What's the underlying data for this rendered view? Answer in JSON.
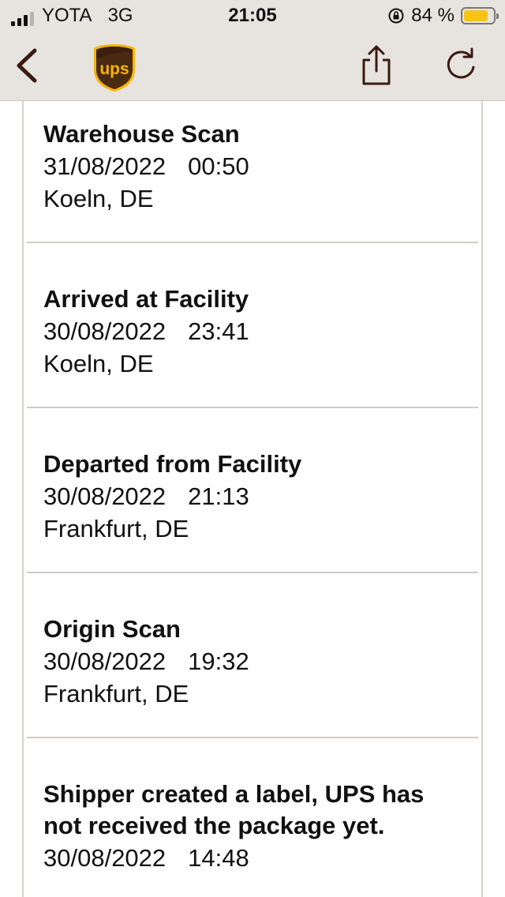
{
  "status_bar": {
    "carrier": "YOTA",
    "network": "3G",
    "time": "21:05",
    "battery_percent": "84 %",
    "battery_level": 0.84,
    "signal_bars_active": 3,
    "battery_color": "#f6c417"
  },
  "nav": {
    "back_icon": "chevron-left-icon",
    "logo_text": "ups",
    "logo_colors": {
      "shield": "#4a2a12",
      "text": "#f7b500"
    },
    "share_icon": "share-icon",
    "reload_icon": "reload-icon",
    "icon_color": "#3a1a10"
  },
  "events": [
    {
      "status": "Warehouse Scan",
      "date": "31/08/2022",
      "time": "00:50",
      "location": "Koeln, DE"
    },
    {
      "status": "Arrived at Facility",
      "date": "30/08/2022",
      "time": "23:41",
      "location": "Koeln, DE"
    },
    {
      "status": "Departed from Facility",
      "date": "30/08/2022",
      "time": "21:13",
      "location": "Frankfurt, DE"
    },
    {
      "status": "Origin Scan",
      "date": "30/08/2022",
      "time": "19:32",
      "location": "Frankfurt, DE"
    },
    {
      "status_line1": "Shipper created a label, UPS has",
      "status_line2": "not received the package yet.",
      "date": "30/08/2022",
      "time": "14:48"
    }
  ]
}
